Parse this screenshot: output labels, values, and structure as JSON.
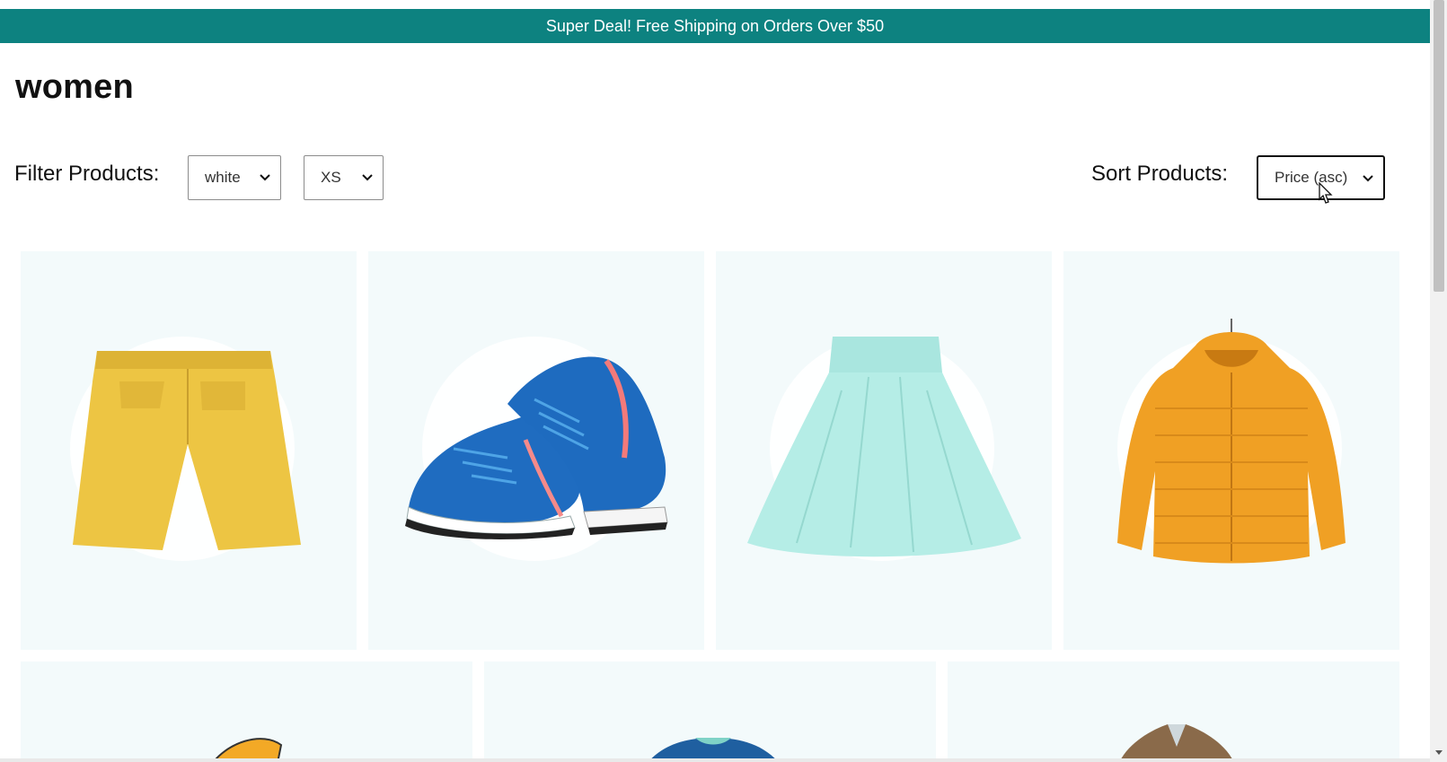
{
  "announcement": {
    "text": "Super Deal! Free Shipping on Orders Over $50"
  },
  "page": {
    "title": "women"
  },
  "filters": {
    "label": "Filter Products:",
    "color": {
      "selected": "white"
    },
    "size": {
      "selected": "XS"
    }
  },
  "sort": {
    "label": "Sort Products:",
    "selected": "Price (asc)"
  },
  "colors": {
    "announcement_bg": "#0d8280",
    "card_bg": "#f3fafb"
  },
  "products": [
    {
      "item": "yellow-shorts"
    },
    {
      "item": "blue-sneakers"
    },
    {
      "item": "mint-skirt"
    },
    {
      "item": "orange-puffer-jacket"
    },
    {
      "item": "orange-item-partial"
    },
    {
      "item": "blue-top-partial"
    },
    {
      "item": "brown-coat-partial"
    }
  ]
}
